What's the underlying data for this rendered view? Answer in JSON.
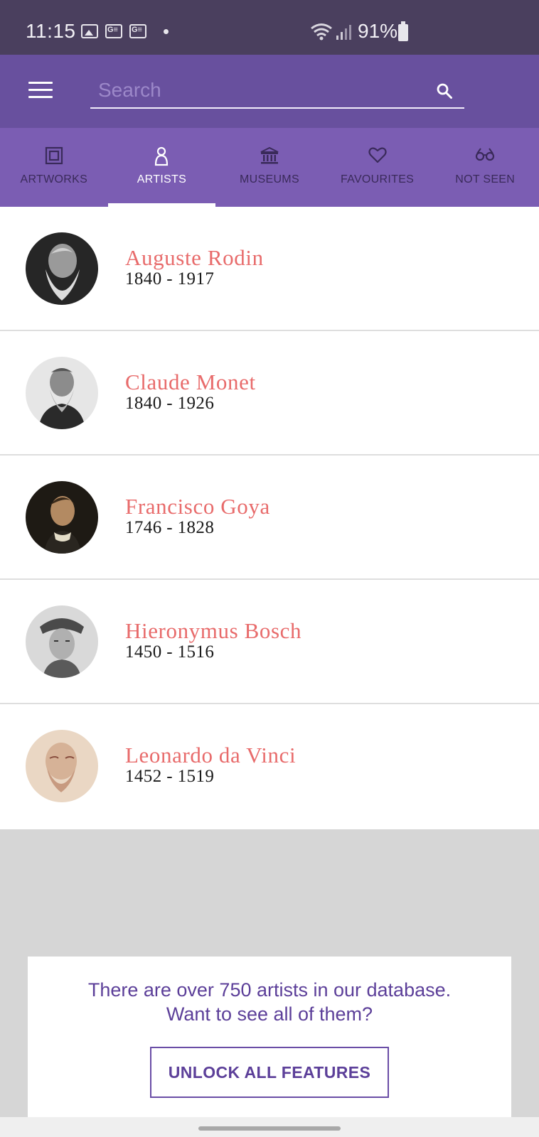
{
  "status_bar": {
    "time": "11:15",
    "battery": "91%",
    "icons": [
      "gallery-icon",
      "google-news-icon",
      "google-news-icon",
      "notification-dot-icon",
      "wifi-icon",
      "signal-icon",
      "battery-icon"
    ]
  },
  "app_bar": {
    "search_placeholder": "Search",
    "menu_icon": "menu-icon",
    "search_icon": "search-icon",
    "color": "#68509e"
  },
  "tabs": [
    {
      "label": "ARTWORKS",
      "icon": "frame-icon",
      "active": false
    },
    {
      "label": "ARTISTS",
      "icon": "person-icon",
      "active": true
    },
    {
      "label": "MUSEUMS",
      "icon": "museum-icon",
      "active": false
    },
    {
      "label": "FAVOURITES",
      "icon": "heart-icon",
      "active": false
    },
    {
      "label": "NOT SEEN",
      "icon": "glasses-icon",
      "active": false
    }
  ],
  "artists": [
    {
      "name": "Auguste Rodin",
      "years": "1840 - 1917"
    },
    {
      "name": "Claude Monet",
      "years": "1840 - 1926"
    },
    {
      "name": "Francisco Goya",
      "years": "1746 - 1828"
    },
    {
      "name": "Hieronymus Bosch",
      "years": "1450 - 1516"
    },
    {
      "name": "Leonardo da Vinci",
      "years": "1452 - 1519"
    }
  ],
  "promo": {
    "line1": "There are over 750 artists in our database.",
    "line2": "Want to see all of them?",
    "button_label": "UNLOCK ALL FEATURES"
  },
  "colors": {
    "accent": "#68509e",
    "tab_bar": "#7b5db3",
    "artist_name": "#e86b6b",
    "promo_text": "#5c3f99"
  }
}
